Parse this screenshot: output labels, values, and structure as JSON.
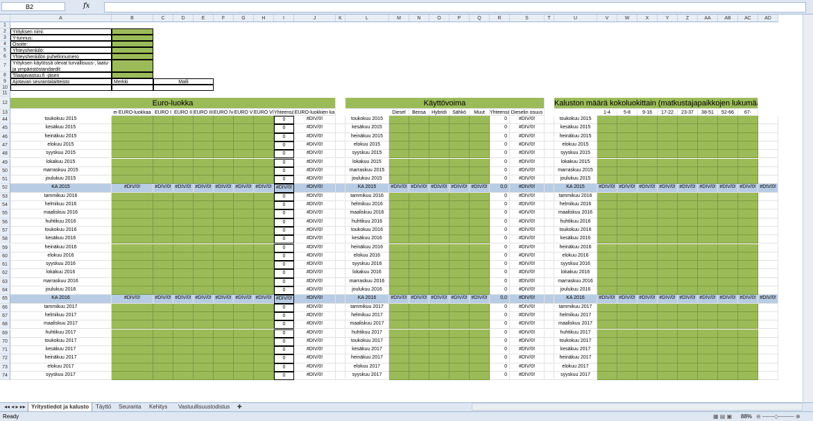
{
  "namebox": "B2",
  "fx": "fx",
  "columns": [
    "A",
    "B",
    "C",
    "D",
    "E",
    "F",
    "G",
    "H",
    "I",
    "J",
    "K",
    "L",
    "M",
    "N",
    "O",
    "P",
    "Q",
    "R",
    "S",
    "T",
    "U",
    "V",
    "W",
    "X",
    "Y",
    "Z",
    "AA",
    "AB",
    "AC",
    "AD"
  ],
  "info_labels": [
    "Yrityksen nimi:",
    "Y-tunnus:",
    "Osoite:",
    "Yhteyshenkilö:",
    "Yhteyshenkilön puhelinnumero",
    "Yrityksen käytössä olevat turvallisuus-, laatu- ja ympäristöstandardit:",
    "Tilaajavastuu.fi -jäsen",
    "Ajotavan seurantalaitteisto"
  ],
  "merkki": "Merkki",
  "malli": "Malli",
  "title_euro": "Euro-luokka",
  "title_kaytto": "Käyttövoima",
  "title_kalusto": "Kaluston määrä kokoluokittain (matkustajapaikkojen lukumäärän mukaan)",
  "euro_headers": [
    "ei EURO-luokkaa",
    "EURO I",
    "EURO II",
    "EURO III",
    "EURO IV",
    "EURO V",
    "EURO VI",
    "Yhteensä",
    "EURO-luokkien ka"
  ],
  "kaytto_headers": [
    "Diesel",
    "Bensa",
    "Hybridi",
    "Sähkö",
    "Muut",
    "Yhteensä",
    "Dieselin osuus"
  ],
  "kalusto_headers": [
    "1-4",
    "5-8",
    "9-16",
    "17-22",
    "23-37",
    "38-51",
    "52-66",
    "67-"
  ],
  "rows": [
    {
      "num": "44",
      "label": "toukokuu 2015",
      "type": "m"
    },
    {
      "num": "45",
      "label": "kesäkuu 2015",
      "type": "m"
    },
    {
      "num": "46",
      "label": "heinäkuu 2015",
      "type": "m"
    },
    {
      "num": "47",
      "label": "elokuu 2015",
      "type": "m"
    },
    {
      "num": "48",
      "label": "syyskuu 2015",
      "type": "m"
    },
    {
      "num": "49",
      "label": "lokakuu 2015",
      "type": "m"
    },
    {
      "num": "50",
      "label": "marraskuu 2015",
      "type": "m"
    },
    {
      "num": "51",
      "label": "joulukuu 2015",
      "type": "m"
    },
    {
      "num": "52",
      "label": "KA 2015",
      "type": "ka"
    },
    {
      "num": "53",
      "label": "tammikuu 2016",
      "type": "m"
    },
    {
      "num": "54",
      "label": "helmikuu 2016",
      "type": "m"
    },
    {
      "num": "55",
      "label": "maaliskuu 2016",
      "type": "m"
    },
    {
      "num": "56",
      "label": "huhtikuu 2016",
      "type": "m"
    },
    {
      "num": "57",
      "label": "toukokuu 2016",
      "type": "m"
    },
    {
      "num": "58",
      "label": "kesäkuu 2016",
      "type": "m"
    },
    {
      "num": "59",
      "label": "heinäkuu 2016",
      "type": "m"
    },
    {
      "num": "60",
      "label": "elokuu 2016",
      "type": "m"
    },
    {
      "num": "61",
      "label": "syyskuu 2016",
      "type": "m"
    },
    {
      "num": "62",
      "label": "lokakuu 2016",
      "type": "m"
    },
    {
      "num": "63",
      "label": "marraskuu 2016",
      "type": "m"
    },
    {
      "num": "64",
      "label": "joulukuu 2016",
      "type": "m"
    },
    {
      "num": "65",
      "label": "KA 2016",
      "type": "ka"
    },
    {
      "num": "66",
      "label": "tammikuu 2017",
      "type": "m"
    },
    {
      "num": "67",
      "label": "helmikuu 2017",
      "type": "m"
    },
    {
      "num": "68",
      "label": "maaliskuu 2017",
      "type": "m"
    },
    {
      "num": "69",
      "label": "huhtikuu 2017",
      "type": "m"
    },
    {
      "num": "70",
      "label": "toukokuu 2017",
      "type": "m"
    },
    {
      "num": "71",
      "label": "kesäkuu 2017",
      "type": "m"
    },
    {
      "num": "72",
      "label": "heinäkuu 2017",
      "type": "m"
    },
    {
      "num": "73",
      "label": "elokuu 2017",
      "type": "m"
    },
    {
      "num": "74",
      "label": "syyskuu 2017",
      "type": "m"
    }
  ],
  "zero": "0",
  "zero_dec": "0,0",
  "divzero": "#DIV/0!",
  "sheets": [
    "Yritystiedot ja kalusto",
    "Täyttö",
    "Seuranta",
    "Kehitys",
    "Vastuullisuustodistus"
  ],
  "status_ready": "Ready",
  "zoom": "88%",
  "colors": {
    "green": "#9bbb59",
    "blue": "#b8cce4"
  }
}
